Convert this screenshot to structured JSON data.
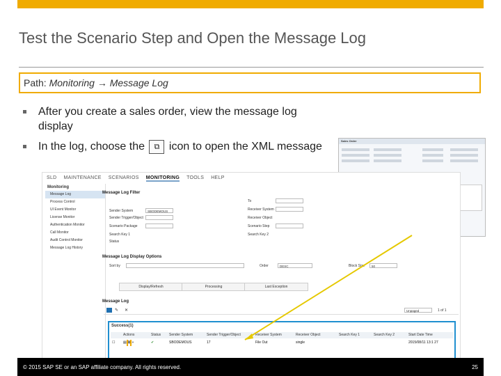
{
  "slide": {
    "title": "Test the Scenario Step and Open the Message Log",
    "path_label": "Path: ",
    "path_value": "Monitoring → Message Log",
    "bullets": [
      "After you create a sales order, view the message log display",
      "In the log, choose the",
      "icon to open the XML message"
    ],
    "footer_copyright": "© 2015 SAP SE or an SAP affiliate company. All rights reserved.",
    "page_number": "25",
    "accent_color": "#f0ab00",
    "highlight_color": "#1f8fd0"
  },
  "screen": {
    "tabs": [
      "SLD",
      "MAINTENANCE",
      "SCENARIOS",
      "MONITORING",
      "TOOLS",
      "HELP"
    ],
    "sidebar": {
      "header": "Monitoring",
      "items": [
        "Message Log",
        "Process Control",
        "UI Event Monitor",
        "License Monitor",
        "Authentication Monitor",
        "Call Monitor",
        "Audit Control Monitor",
        "Message Log History"
      ]
    },
    "filter": {
      "title": "Message Log Filter",
      "sender_system_label": "Sender System",
      "sender_system_value": "SBODEMOUS",
      "sender_trigger_label": "Sender Trigger/Object",
      "scenario_package_label": "Scenario Package",
      "search_key1_label": "Search Key 1",
      "status_label": "Status",
      "to_label": "To",
      "receiver_system_label": "Receiver System",
      "receiver_object_label": "Receiver Object",
      "scenario_step_label": "Scenario Step",
      "search_key2_label": "Search Key 2"
    },
    "display_options": {
      "title": "Message Log Display Options",
      "sort_by_label": "Sort by",
      "order_label": "Order",
      "order_value": "DESC",
      "block_size_label": "Block Size",
      "block_size_value": "50"
    },
    "buttons": [
      "Display/Refresh",
      "Processing",
      "Last Exception"
    ],
    "log": {
      "title": "Message Log",
      "section": "Success(1)",
      "view_select": "Unpaged",
      "pager": "1 of 1",
      "columns": [
        "",
        "Actions",
        "Status",
        "Sender System",
        "Sender Trigger/Object",
        "Receiver System",
        "Receiver Object",
        "Search Key 1",
        "Search Key 2",
        "Start Date Time"
      ],
      "row": [
        "",
        "",
        "",
        "SBODEMOUS",
        "17",
        "File Out",
        "single",
        "",
        "",
        "2015/08/11 13:1 27"
      ]
    }
  },
  "inset": {
    "title": "Sales Order",
    "tabs": [
      "Contents",
      "Logistics",
      "Accounting",
      "Attachments"
    ]
  }
}
